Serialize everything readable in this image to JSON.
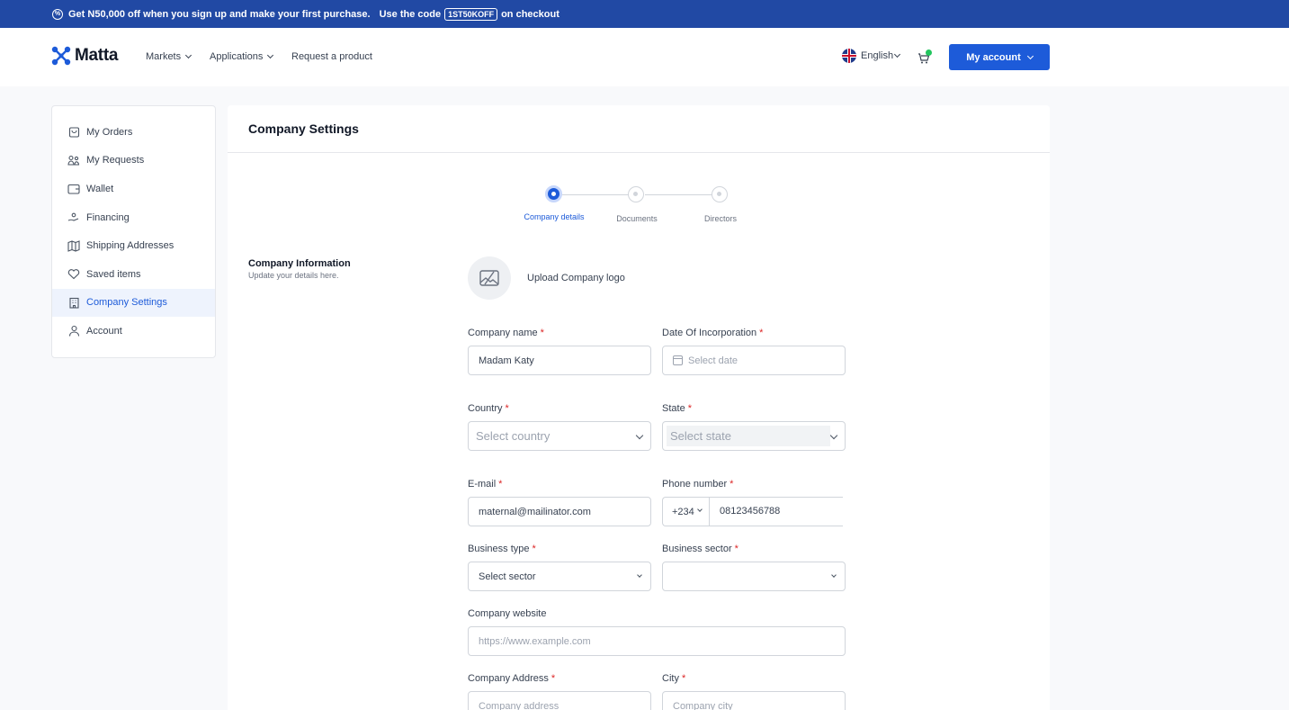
{
  "promo": {
    "text": "Get N50,000 off when you sign up and make your first purchase.",
    "code_prefix": "Use the code",
    "code": "1ST50KOFF",
    "code_suffix": "on checkout"
  },
  "nav": {
    "logo": "Matta",
    "markets": "Markets",
    "applications": "Applications",
    "request": "Request a product",
    "language": "English",
    "account": "My account"
  },
  "sidebar": {
    "items": [
      {
        "label": "My Orders",
        "icon": "bag-icon"
      },
      {
        "label": "My Requests",
        "icon": "requests-icon"
      },
      {
        "label": "Wallet",
        "icon": "wallet-icon"
      },
      {
        "label": "Financing",
        "icon": "financing-icon"
      },
      {
        "label": "Shipping Addresses",
        "icon": "map-icon"
      },
      {
        "label": "Saved items",
        "icon": "heart-icon"
      },
      {
        "label": "Company Settings",
        "icon": "building-icon"
      },
      {
        "label": "Account",
        "icon": "user-icon"
      }
    ],
    "active_index": 6
  },
  "main": {
    "title": "Company Settings",
    "steps": [
      "Company details",
      "Documents",
      "Directors"
    ],
    "active_step": 0,
    "section_title": "Company Information",
    "section_sub": "Update your details here.",
    "upload_label": "Upload Company logo"
  },
  "form": {
    "company_name_label": "Company name",
    "company_name_value": "Madam Katy",
    "incorporation_label": "Date Of Incorporation",
    "incorporation_placeholder": "Select date",
    "country_label": "Country",
    "country_placeholder": "Select country",
    "state_label": "State",
    "state_placeholder": "Select state",
    "email_label": "E-mail",
    "email_value": "maternal@mailinator.com",
    "phone_label": "Phone number",
    "phone_code": "+234",
    "phone_value": "08123456788",
    "business_type_label": "Business type",
    "business_type_value": "Select sector",
    "business_sector_label": "Business sector",
    "business_sector_value": "",
    "website_label": "Company website",
    "website_placeholder": "https://www.example.com",
    "address_label": "Company Address",
    "address_placeholder": "Company address",
    "city_label": "City",
    "city_placeholder": "Company city",
    "required_mark": "*"
  },
  "colors": {
    "brand": "#1d5bd9",
    "promo_bg": "#2149a4",
    "required": "#dc2626",
    "cart_badge": "#22c55e"
  }
}
